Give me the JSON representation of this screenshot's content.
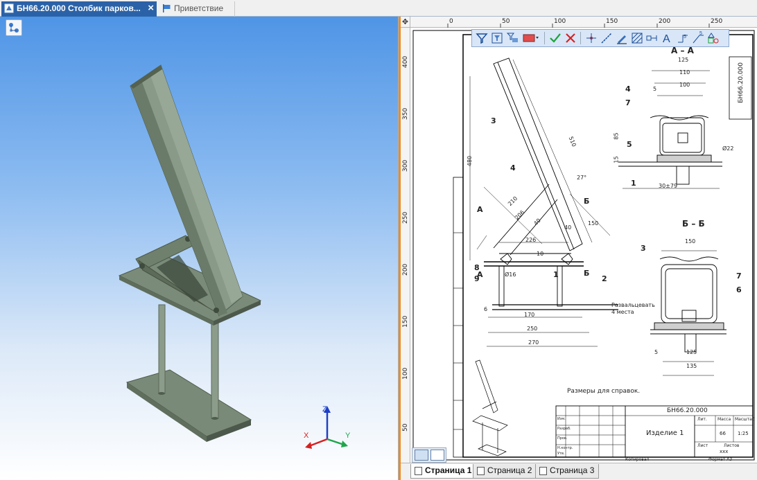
{
  "tabs": [
    {
      "label": "БН66.20.000 Столбик парков...",
      "active": true
    },
    {
      "label": "Приветствие",
      "active": false
    }
  ],
  "ruler": {
    "horizontal": [
      "0",
      "50",
      "100",
      "150",
      "200",
      "250"
    ],
    "vertical": [
      "400",
      "350",
      "300",
      "250",
      "200",
      "150",
      "100",
      "50"
    ],
    "corner_icon": "move-cross-icon"
  },
  "drawing": {
    "section_aa": "А – А",
    "section_bb": "Б – Б",
    "note": "Размеры для справок.",
    "callouts": [
      "1",
      "2",
      "3",
      "4",
      "5",
      "6",
      "7",
      "8",
      "9"
    ],
    "section_marks": [
      "А",
      "А",
      "Б",
      "Б"
    ],
    "dims": [
      "125",
      "110",
      "100",
      "5",
      "85",
      "15",
      "30±79",
      "510",
      "480",
      "27°",
      "210",
      "206",
      "40",
      "40",
      "150",
      "226",
      "10",
      "Ø16",
      "170",
      "250",
      "270",
      "6",
      "150",
      "135",
      "125",
      "5",
      "Ø22"
    ],
    "weld_note": [
      "Развальцевать",
      "4 места"
    ],
    "stamp_code_vertical": "БН66.20.000",
    "title_block": {
      "designation": "БН66.20.000",
      "name": "Изделие 1",
      "headers": [
        "Лит.",
        "Масса",
        "Масштаб"
      ],
      "mass": "66",
      "scale": "1:25",
      "sheet": "Лист",
      "sheets": "Листов",
      "org": "ххх",
      "copied": "Копировал",
      "format": "Формат  А3",
      "rows": [
        "Изм.",
        "Лист",
        "№ докум.",
        "Подп.",
        "Дата",
        "Разраб.",
        "Пров.",
        "Т.контр.",
        "Н.контр.",
        "Утв."
      ]
    }
  },
  "axes": {
    "x": "X",
    "y": "Y",
    "z": "Z"
  },
  "page_tabs": [
    {
      "label": "Страница 1",
      "active": true
    },
    {
      "label": "Страница 2",
      "active": false
    },
    {
      "label": "Страница 3",
      "active": false
    }
  ],
  "colors": {
    "accent": "#2b62a7",
    "divider": "#f08a1e",
    "model": "#7f9080"
  }
}
